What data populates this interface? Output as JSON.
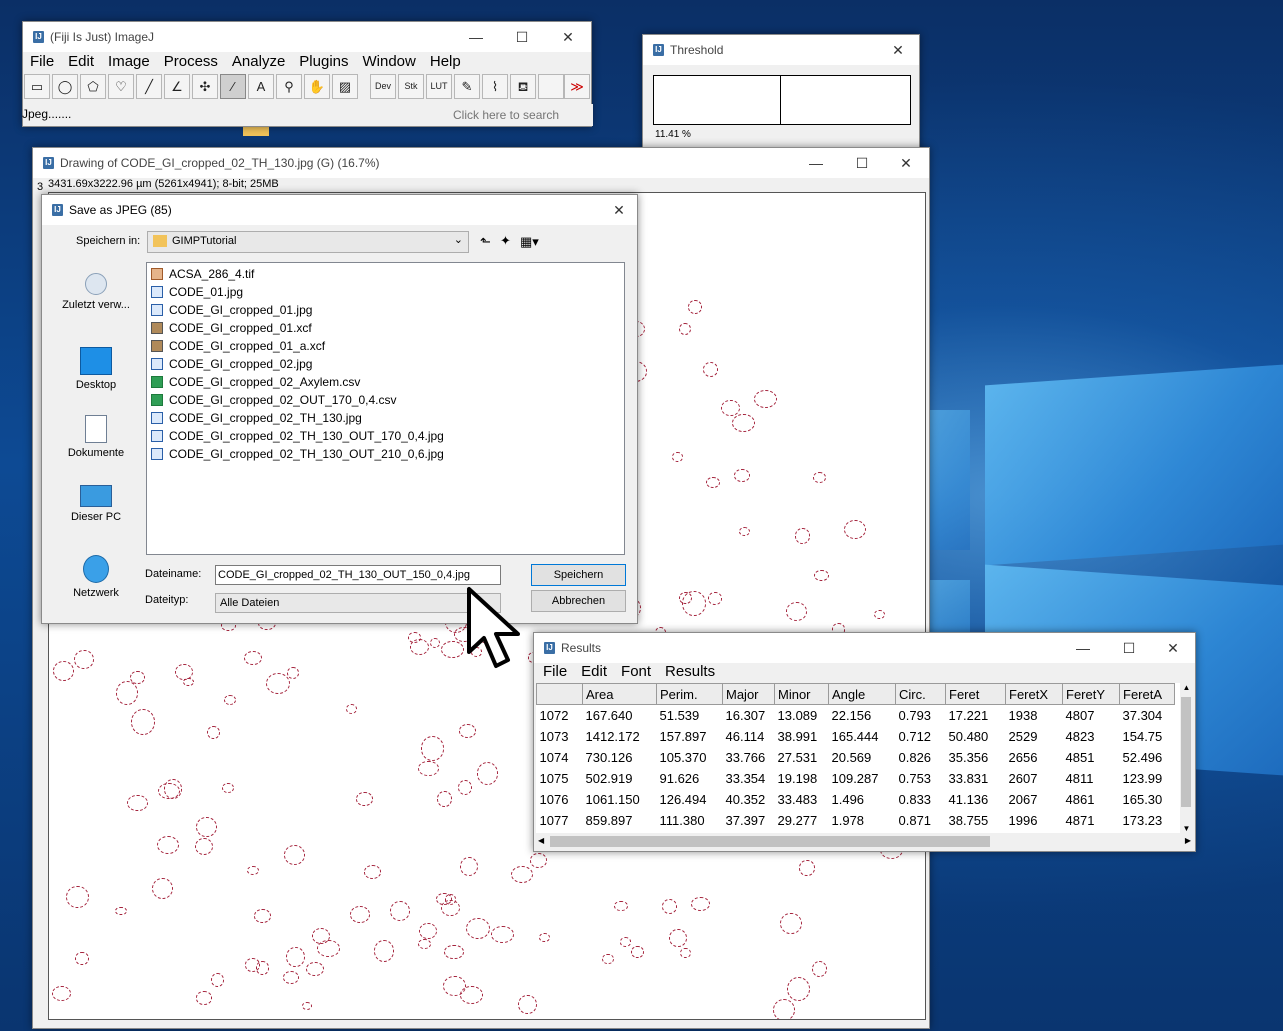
{
  "imagej": {
    "title": "(Fiji Is Just) ImageJ",
    "menu": [
      "File",
      "Edit",
      "Image",
      "Process",
      "Analyze",
      "Plugins",
      "Window",
      "Help"
    ],
    "tools": [
      "rectangle-icon",
      "oval-icon",
      "polygon-icon",
      "freehand-icon",
      "line-icon",
      "angle-icon",
      "point-icon",
      "wand-icon",
      "text-icon",
      "magnifier-icon",
      "hand-icon",
      "color-picker-icon"
    ],
    "tool_text": {
      "dev": "Dev",
      "stk": "Stk",
      "lut": "LUT",
      "more": "≫"
    },
    "status": "Jpeg.......",
    "search_placeholder": "Click here to search"
  },
  "threshold": {
    "title": "Threshold",
    "percent": "11.41 %"
  },
  "drawing": {
    "title": "Drawing of CODE_GI_cropped_02_TH_130.jpg (G) (16.7%)",
    "info": "3431.69x3222.96 µm (5261x4941); 8-bit; 25MB",
    "cutoff_char": "3"
  },
  "save_dialog": {
    "title": "Save as JPEG (85)",
    "save_in_label": "Speichern in:",
    "folder": "GIMPTutorial",
    "places": [
      "Zuletzt verw...",
      "Desktop",
      "Dokumente",
      "Dieser PC",
      "Netzwerk"
    ],
    "files": [
      {
        "name": "ACSA_286_4.tif",
        "type": "tif"
      },
      {
        "name": "CODE_01.jpg",
        "type": "img"
      },
      {
        "name": "CODE_GI_cropped_01.jpg",
        "type": "img"
      },
      {
        "name": "CODE_GI_cropped_01.xcf",
        "type": "xcf"
      },
      {
        "name": "CODE_GI_cropped_01_a.xcf",
        "type": "xcf"
      },
      {
        "name": "CODE_GI_cropped_02.jpg",
        "type": "img"
      },
      {
        "name": "CODE_GI_cropped_02_Axylem.csv",
        "type": "csv"
      },
      {
        "name": "CODE_GI_cropped_02_OUT_170_0,4.csv",
        "type": "csv"
      },
      {
        "name": "CODE_GI_cropped_02_TH_130.jpg",
        "type": "img"
      },
      {
        "name": "CODE_GI_cropped_02_TH_130_OUT_170_0,4.jpg",
        "type": "img"
      },
      {
        "name": "CODE_GI_cropped_02_TH_130_OUT_210_0,6.jpg",
        "type": "img"
      }
    ],
    "filename_label": "Dateiname:",
    "filename_value": "CODE_GI_cropped_02_TH_130_OUT_150_0,4.jpg",
    "filetype_label": "Dateityp:",
    "filetype_value": "Alle Dateien",
    "save_button": "Speichern",
    "cancel_button": "Abbrechen"
  },
  "results": {
    "title": "Results",
    "menu": [
      "File",
      "Edit",
      "Font",
      "Results"
    ],
    "columns": [
      "",
      "Area",
      "Perim.",
      "Major",
      "Minor",
      "Angle",
      "Circ.",
      "Feret",
      "FeretX",
      "FeretY",
      "FeretA"
    ],
    "rows": [
      [
        "1072",
        "167.640",
        "51.539",
        "16.307",
        "13.089",
        "22.156",
        "0.793",
        "17.221",
        "1938",
        "4807",
        "37.304"
      ],
      [
        "1073",
        "1412.172",
        "157.897",
        "46.114",
        "38.991",
        "165.444",
        "0.712",
        "50.480",
        "2529",
        "4823",
        "154.75"
      ],
      [
        "1074",
        "730.126",
        "105.370",
        "33.766",
        "27.531",
        "20.569",
        "0.826",
        "35.356",
        "2656",
        "4851",
        "52.496"
      ],
      [
        "1075",
        "502.919",
        "91.626",
        "33.354",
        "19.198",
        "109.287",
        "0.753",
        "33.831",
        "2607",
        "4811",
        "123.99"
      ],
      [
        "1076",
        "1061.150",
        "126.494",
        "40.352",
        "33.483",
        "1.496",
        "0.833",
        "41.136",
        "2067",
        "4861",
        "165.30"
      ],
      [
        "1077",
        "859.897",
        "111.380",
        "37.397",
        "29.277",
        "1.978",
        "0.871",
        "38.755",
        "1996",
        "4871",
        "173.23"
      ]
    ]
  },
  "colors": {
    "cell_outline": "#a4233c",
    "desktop_blue": "#0d4a94",
    "window_light": "#5fbaf2"
  }
}
